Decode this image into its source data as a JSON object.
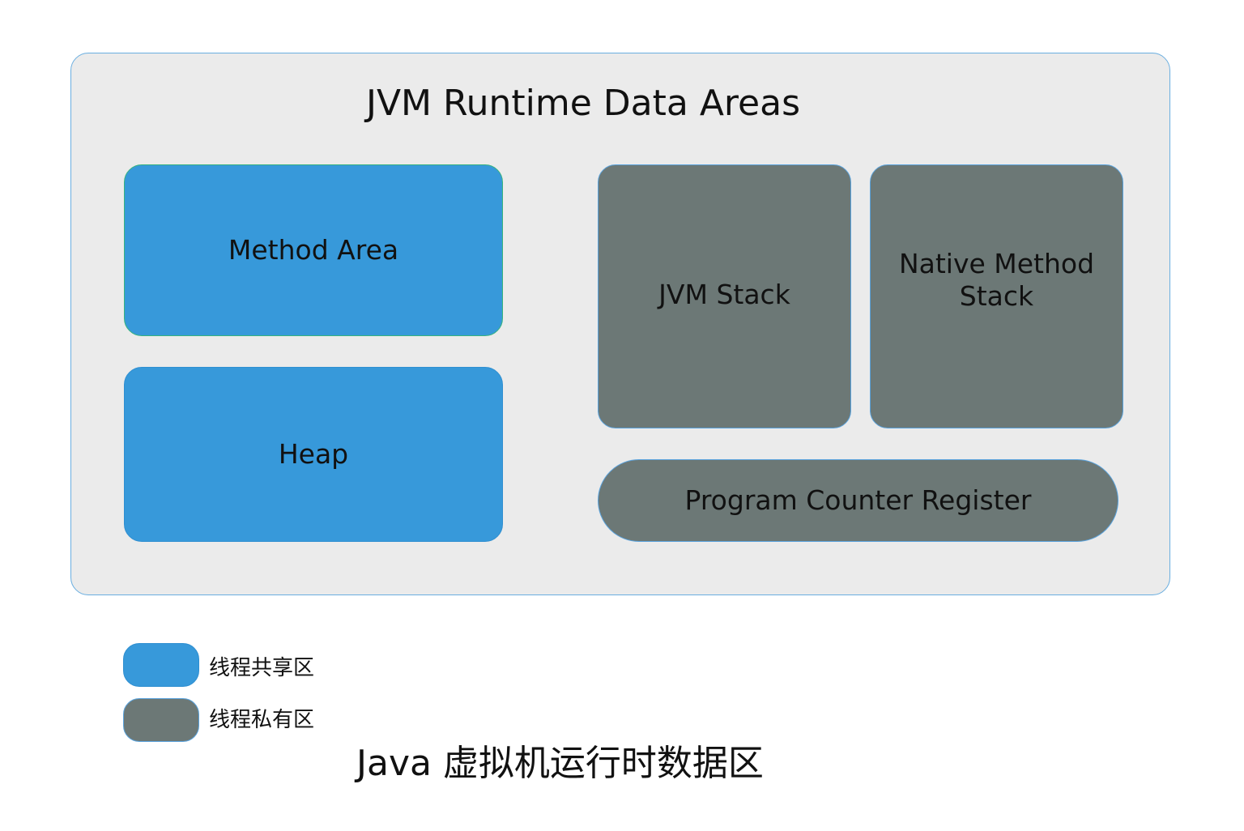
{
  "diagram": {
    "title": "JVM Runtime Data Areas",
    "boxes": {
      "method_area": "Method Area",
      "heap": "Heap",
      "jvm_stack": "JVM Stack",
      "native_method_stack_line1": "Native Method",
      "native_method_stack_line2": "Stack",
      "program_counter_register": "Program Counter Register"
    },
    "legend": {
      "shared": "线程共享区",
      "private": "线程私有区"
    },
    "caption": "Java 虚拟机运行时数据区",
    "colors": {
      "shared": "#3799da",
      "private": "#6c7876",
      "container": "#ebebeb",
      "border": "#6aaee0"
    }
  }
}
